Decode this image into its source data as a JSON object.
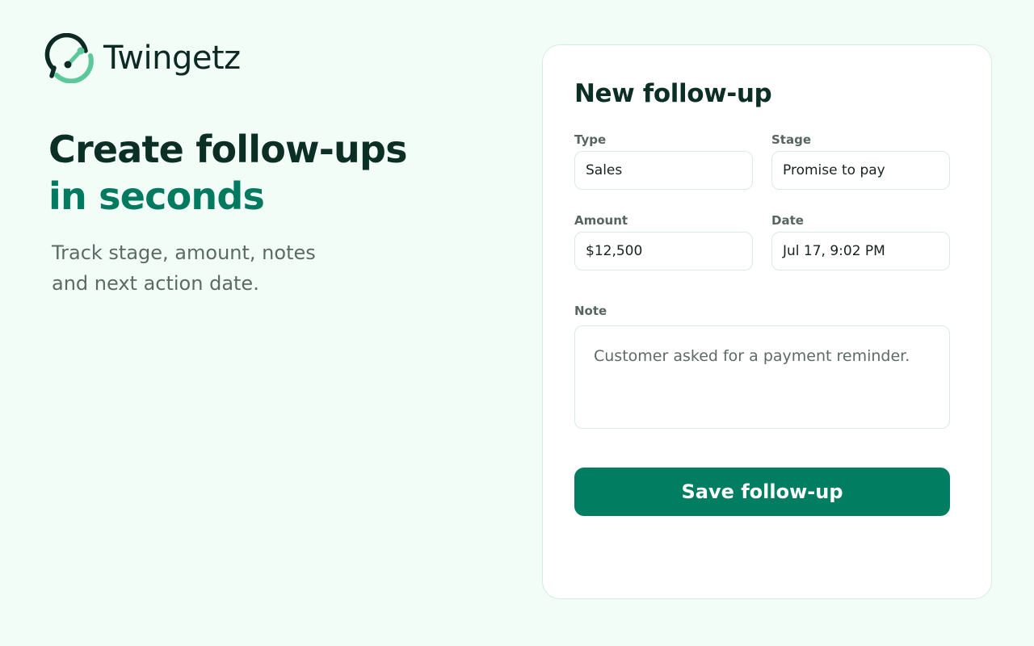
{
  "brand": {
    "name": "Twingetz",
    "logo_icon": "loop-arrow-logo-icon",
    "colors": {
      "dark": "#0c2a23",
      "accent": "#5cc79a"
    }
  },
  "hero": {
    "title_line1": "Create follow-ups",
    "title_line2": "in seconds",
    "subtitle_line1": "Track stage, amount, notes",
    "subtitle_line2": "and next action date."
  },
  "form": {
    "title": "New follow-up",
    "fields": {
      "type": {
        "label": "Type",
        "value": "Sales"
      },
      "stage": {
        "label": "Stage",
        "value": "Promise to pay"
      },
      "amount": {
        "label": "Amount",
        "value": "$12,500"
      },
      "date": {
        "label": "Date",
        "value": "Jul 17, 9:02 PM"
      },
      "note": {
        "label": "Note",
        "value": "Customer asked for a payment reminder."
      }
    },
    "save_label": "Save follow-up"
  },
  "colors": {
    "background": "#f3fdf8",
    "primary": "#017e62",
    "accent_text": "#017a60"
  }
}
